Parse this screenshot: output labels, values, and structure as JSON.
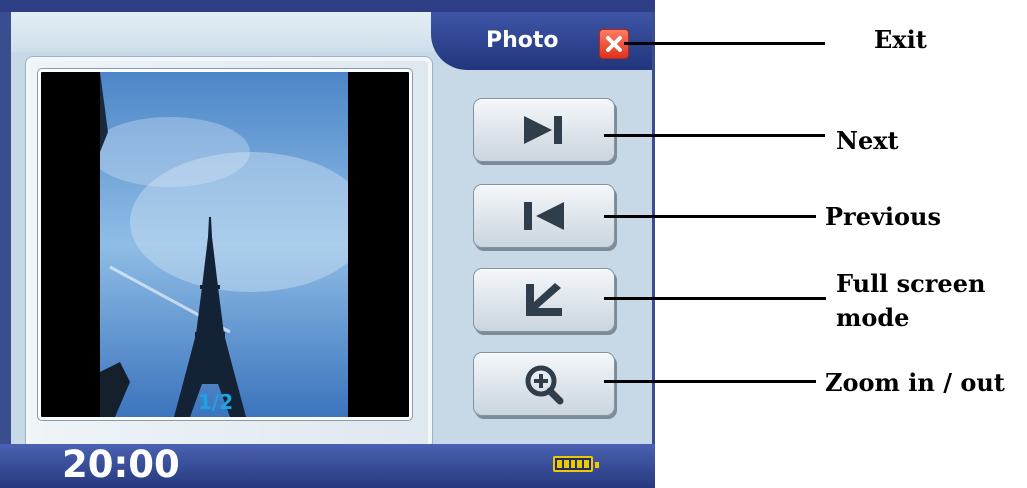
{
  "title": "Photo",
  "photo": {
    "counter": "1/2"
  },
  "status_bar": {
    "time": "20:00",
    "battery_level": 1.0
  },
  "buttons": {
    "exit_icon": "close-icon",
    "next_icon": "skip-next-icon",
    "previous_icon": "skip-previous-icon",
    "fullscreen_icon": "fullscreen-arrow-icon",
    "zoom_icon": "zoom-in-icon"
  },
  "annotations": {
    "exit": "Exit",
    "next": "Next",
    "previous": "Previous",
    "fullscreen_line1": "Full screen",
    "fullscreen_line2": "mode",
    "zoom": "Zoom in / out"
  },
  "colors": {
    "frame": "#3a4d8f",
    "screen": "#c7d9e6",
    "exit_red": "#e0321c",
    "counter": "#1aa4e6",
    "battery": "#f0c800",
    "icon": "#2f3e4a"
  }
}
